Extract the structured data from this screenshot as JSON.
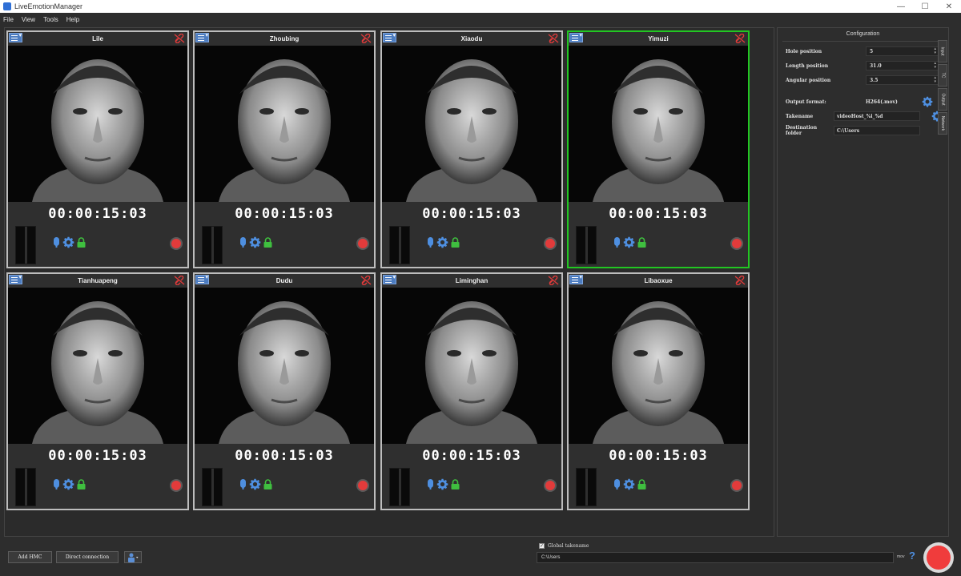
{
  "window": {
    "title": "LiveEmotionManager"
  },
  "menu": [
    "File",
    "View",
    "Tools",
    "Help"
  ],
  "cameras": [
    {
      "name": "Lile",
      "timer": "00:00:15:03",
      "selected": false
    },
    {
      "name": "Zhoubing",
      "timer": "00:00:15:03",
      "selected": false
    },
    {
      "name": "Xiaodu",
      "timer": "00:00:15:03",
      "selected": false
    },
    {
      "name": "Yimuzi",
      "timer": "00:00:15:03",
      "selected": true
    },
    {
      "name": "Tianhuapeng",
      "timer": "00:00:15:03",
      "selected": false
    },
    {
      "name": "Dudu",
      "timer": "00:00:15:03",
      "selected": false
    },
    {
      "name": "Liminghan",
      "timer": "00:00:15:03",
      "selected": false
    },
    {
      "name": "Libaoxue",
      "timer": "00:00:15:03",
      "selected": false
    }
  ],
  "config": {
    "title": "Configuration",
    "hole_label": "Hole position",
    "hole_value": "5",
    "length_label": "Length position",
    "length_value": "31.0",
    "angular_label": "Angular position",
    "angular_value": "3.5",
    "output_label": "Output format:",
    "output_value": "H264(.mov)",
    "take_label": "Takename",
    "take_value": "videoHost_%i_%d",
    "dest_label": "Destination folder",
    "dest_value": "C:\\Users",
    "tabs": [
      "Input",
      "TC",
      "Output",
      "Network"
    ]
  },
  "bottom": {
    "add_hmc": "Add HMC",
    "direct": "Direct connection",
    "global_takename": "Global takename",
    "global_checked": "✓",
    "path": "C:\\Users",
    "suffix": "mov",
    "help": "?"
  },
  "colors": {
    "selected_border": "#22c622",
    "record_red": "#e23b3b",
    "accent_blue": "#4e8fe0",
    "lock_green": "#3fbf3f"
  }
}
